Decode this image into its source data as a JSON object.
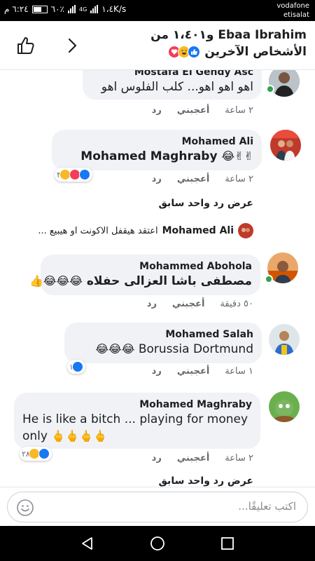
{
  "status": {
    "time": "٦:٢٤ م",
    "battery": "٦٠٪",
    "network": "4G",
    "speed": "١،٤K/s",
    "carrier_1": "vodafone",
    "carrier_2": "etisalat"
  },
  "header": {
    "line1": "Ebaa Ibrahim و١،٤٠١ من",
    "line2": "الأشخاص الآخرين"
  },
  "comments": [
    {
      "name": "Mostafa El Gendy Asc",
      "text": "اهو اهو اهو...  كلب الفلوس اهو",
      "time": "٢ ساعة",
      "like": "أعجبني",
      "reply": "رد"
    },
    {
      "name": "Mohamed Ali",
      "text": "Mohamed Maghraby",
      "emojis": "😂✌✌",
      "time": "٢ ساعة",
      "like": "أعجبني",
      "reply": "رد",
      "reaction_count": "٣"
    },
    {
      "name": "Mohammed Abohola",
      "text": "مصطفى باشا العزالى حفلاه",
      "emojis": "😂😂😂👍",
      "time": "٥٠ دقيقة",
      "like": "أعجبني",
      "reply": "رد"
    },
    {
      "name": "Mohamed Salah",
      "text": "Borussia Dortmund",
      "emojis": "😂😂😂",
      "time": "١ ساعة",
      "like": "أعجبني",
      "reply": "رد",
      "reaction_count": "١"
    },
    {
      "name": "Mohamed Maghraby",
      "text": "He is like a bitch ... playing for money only",
      "emojis": "🖕🖕🖕🖕",
      "time": "٢ ساعة",
      "like": "أعجبني",
      "reply": "رد",
      "reaction_count": "٢٨"
    }
  ],
  "replies": {
    "view_previous_1": "عرض رد واحد سابق",
    "preview_name": "Mohamed Ali",
    "preview_text": "اعتقد هيقفل الاكونت او هيبيع ...",
    "view_previous_2": "عرض رد واحد سابق"
  },
  "composer": {
    "placeholder": "اكتب تعليقًا..."
  },
  "colors": {
    "like_blue": "#1877f2",
    "love_red": "#f33e58",
    "haha_yellow": "#f7b928",
    "online_green": "#31a24c",
    "bubble_gray": "#f0f2f5"
  },
  "icons": [
    "like-thumb-icon",
    "chevron-right-icon",
    "smiley-icon",
    "back-icon",
    "home-icon",
    "recents-icon"
  ]
}
